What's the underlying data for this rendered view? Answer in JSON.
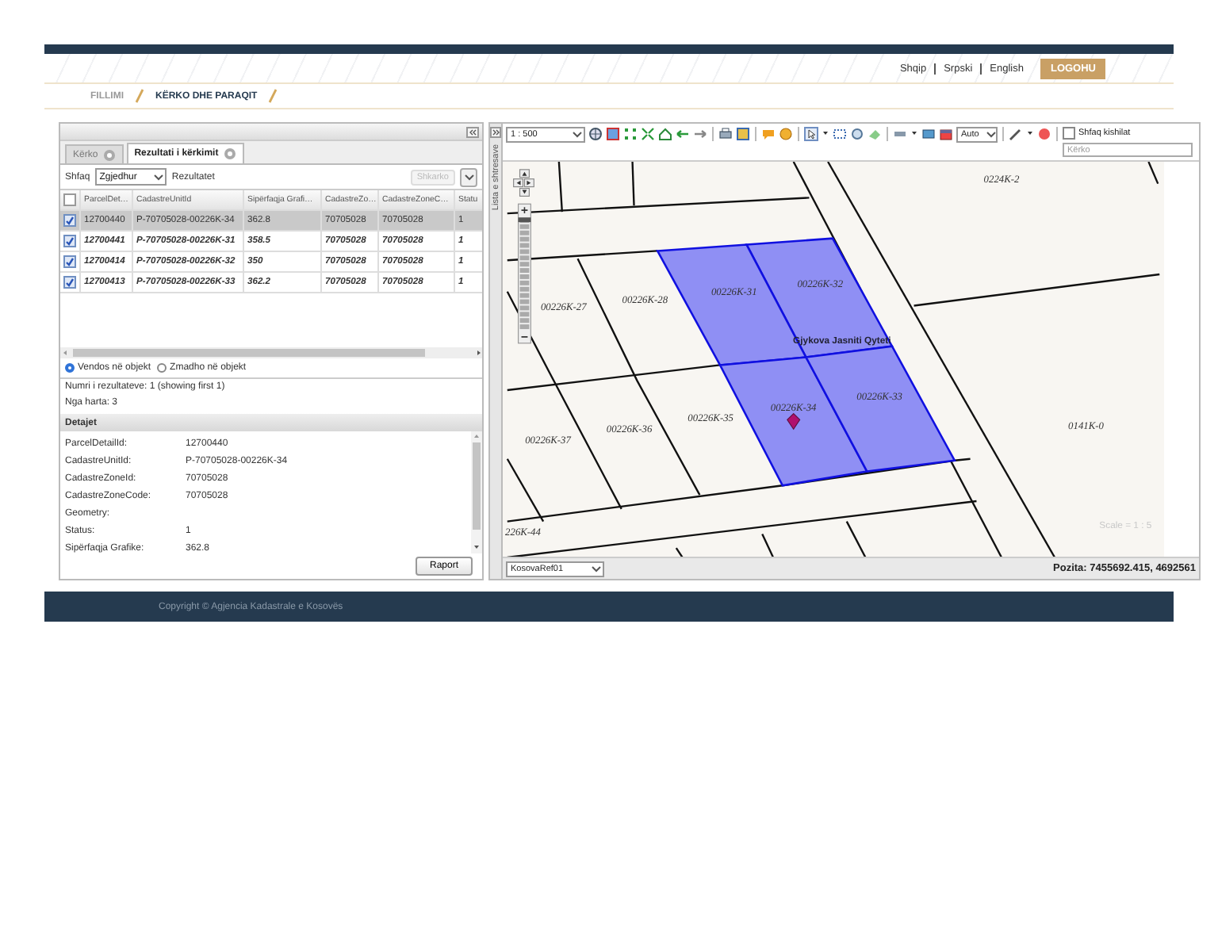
{
  "header": {
    "languages": [
      {
        "label": "Shqip"
      },
      {
        "label": "Srpski"
      },
      {
        "label": "English"
      }
    ],
    "login_button": "LOGOHU"
  },
  "breadcrumb": [
    {
      "label": "FILLIMI",
      "selected": false
    },
    {
      "label": "KËRKO DHE PARAQIT",
      "selected": true
    }
  ],
  "left_panel": {
    "tabs": [
      {
        "label": "Kërko",
        "selected": false
      },
      {
        "label": "Rezultati i kërkimit",
        "selected": true
      }
    ],
    "show_label": "Shfaq",
    "show_select": "Zgjedhur",
    "results_label": "Rezultatet",
    "download_button": {
      "label": "Shkarko",
      "disabled": true
    },
    "table": {
      "header_checked": false,
      "columns": [
        "ParcelDet…",
        "CadastreUnitId",
        "Sipërfaqja Grafi…",
        "CadastreZo…",
        "CadastreZoneC…",
        "Statu"
      ],
      "rows": [
        {
          "checked": true,
          "selected": true,
          "cells": [
            "12700440",
            "P-70705028-00226K-34",
            "362.8",
            "70705028",
            "70705028",
            "1"
          ]
        },
        {
          "checked": true,
          "selected": false,
          "cells": [
            "12700441",
            "P-70705028-00226K-31",
            "358.5",
            "70705028",
            "70705028",
            "1"
          ]
        },
        {
          "checked": true,
          "selected": false,
          "cells": [
            "12700414",
            "P-70705028-00226K-32",
            "350",
            "70705028",
            "70705028",
            "1"
          ]
        },
        {
          "checked": true,
          "selected": false,
          "cells": [
            "12700413",
            "P-70705028-00226K-33",
            "362.2",
            "70705028",
            "70705028",
            "1"
          ]
        }
      ]
    },
    "radios": [
      {
        "label": "Vendos në objekt",
        "selected": true
      },
      {
        "label": "Zmadho në objekt",
        "selected": false
      }
    ],
    "result_count": "Numri i rezultateve: 1 (showing first 1)",
    "from_map": "Nga harta: 3",
    "details_title": "Detajet",
    "details": [
      {
        "label": "ParcelDetailId:",
        "value": "12700440"
      },
      {
        "label": "CadastreUnitId:",
        "value": "P-70705028-00226K-34"
      },
      {
        "label": "CadastreZoneId:",
        "value": "70705028"
      },
      {
        "label": "CadastreZoneCode:",
        "value": "70705028"
      },
      {
        "label": "Geometry:"
      },
      {
        "label": "Status:",
        "value": "1"
      },
      {
        "label": "Sipërfaqja Grafike:",
        "value": "362.8"
      }
    ],
    "report_button": "Raport"
  },
  "map": {
    "sidebar_label": "Lista e shtresave",
    "scale_select": "1 : 500",
    "auto_select": "Auto",
    "tips_checkbox": {
      "label": "Shfaq kishilat",
      "checked": false
    },
    "search": {
      "placeholder": "Kërko"
    },
    "parcels": [
      {
        "label": "0224K-2",
        "highlighted": false
      },
      {
        "label": "00226K-32",
        "highlighted": true
      },
      {
        "label": "00226K-31",
        "highlighted": true
      },
      {
        "label": "00226K-28",
        "highlighted": false
      },
      {
        "label": "00226K-27",
        "highlighted": false
      },
      {
        "label": "00226K-34",
        "highlighted": true
      },
      {
        "label": "00226K-33",
        "highlighted": true
      },
      {
        "label": "0141K-0",
        "highlighted": false
      },
      {
        "label": "00226K-35",
        "highlighted": false
      },
      {
        "label": "00226K-36",
        "highlighted": false
      },
      {
        "label": "00226K-37",
        "highlighted": false
      },
      {
        "label": "226K-44",
        "highlighted": false
      }
    ],
    "place_label": "Gjykova Jasniti Qyteti",
    "zoom_slider": {
      "level": 0.9
    },
    "scale_text": "Scale = 1 : 5",
    "crs_select": "KosovaRef01",
    "position": "Pozita: 7455692.415, 4692561"
  },
  "footer": "Copyright © Agjencia Kadastrale e Kosovës"
}
